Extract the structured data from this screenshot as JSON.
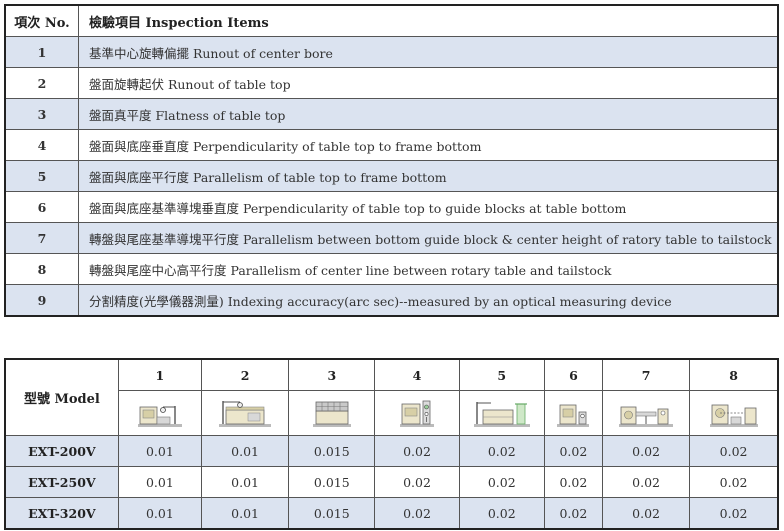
{
  "inspection_table": {
    "header": {
      "no": "項次 No.",
      "item": "檢驗項目 Inspection Items"
    },
    "rows": [
      {
        "no": "1",
        "desc": "基準中心旋轉偏擺 Runout of center bore"
      },
      {
        "no": "2",
        "desc": "盤面旋轉起伏 Runout of table top"
      },
      {
        "no": "3",
        "desc": "盤面真平度 Flatness of table top"
      },
      {
        "no": "4",
        "desc": "盤面與底座垂直度 Perpendicularity of table top to frame bottom"
      },
      {
        "no": "5",
        "desc": "盤面與底座平行度 Parallelism of table top to frame bottom"
      },
      {
        "no": "6",
        "desc": "盤面與底座基準導塊垂直度 Perpendicularity of table top to guide blocks at table bottom"
      },
      {
        "no": "7",
        "desc": "轉盤與尾座基準導塊平行度 Parallelism between bottom guide block & center height of ratory table to tailstock"
      },
      {
        "no": "8",
        "desc": "轉盤與尾座中心高平行度 Parallelism of center line between rotary table and tailstock"
      },
      {
        "no": "9",
        "desc": "分割精度(光學儀器測量) Indexing accuracy(arc sec)--measured by an optical measuring device"
      }
    ]
  },
  "model_table": {
    "model_header": "型號 Model",
    "columns": [
      "1",
      "2",
      "3",
      "4",
      "5",
      "6",
      "7",
      "8"
    ],
    "icons": [
      "inspection-setup-1-icon",
      "inspection-setup-2-icon",
      "inspection-setup-3-icon",
      "inspection-setup-4-icon",
      "inspection-setup-5-icon",
      "inspection-setup-6-icon",
      "inspection-setup-7-icon",
      "inspection-setup-8-icon"
    ],
    "rows": [
      {
        "model": "EXT-200V",
        "values": [
          "0.01",
          "0.01",
          "0.015",
          "0.02",
          "0.02",
          "0.02",
          "0.02",
          "0.02"
        ]
      },
      {
        "model": "EXT-250V",
        "values": [
          "0.01",
          "0.01",
          "0.015",
          "0.02",
          "0.02",
          "0.02",
          "0.02",
          "0.02"
        ]
      },
      {
        "model": "EXT-320V",
        "values": [
          "0.01",
          "0.01",
          "0.015",
          "0.02",
          "0.02",
          "0.02",
          "0.02",
          "0.02"
        ]
      }
    ]
  }
}
